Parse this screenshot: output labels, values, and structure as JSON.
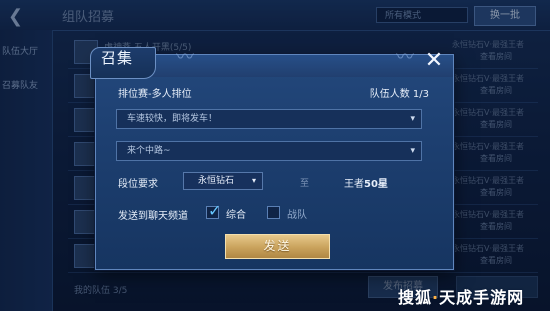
{
  "background": {
    "top_title": "组队招募",
    "top_select": "所有模式",
    "top_button": "换一批",
    "sidebar": [
      "队伍大厅",
      "召募队友"
    ],
    "rows": [
      {
        "name": "虎神燕  五人开黑(5/5)",
        "rank": "永恒钻石V·最强王者",
        "action": "查看房间"
      },
      {
        "name": "",
        "rank": "永恒钻石V·最强王者",
        "action": "查看房间"
      },
      {
        "name": "",
        "rank": "永恒钻石V·最强王者",
        "action": "查看房间"
      },
      {
        "name": "",
        "rank": "永恒钻石V·最强王者",
        "action": "查看房间"
      },
      {
        "name": "",
        "rank": "永恒钻石V·最强王者",
        "action": "查看房间"
      },
      {
        "name": "",
        "rank": "永恒钻石V·最强王者",
        "action": "查看房间"
      },
      {
        "name": "",
        "rank": "永恒钻石V·最强王者",
        "action": "查看房间"
      }
    ],
    "my_team": "我的队伍 3/5",
    "bottom_button": "发布招募"
  },
  "dialog": {
    "title": "召集",
    "close": "✕",
    "mode_label": "排位赛-多人排位",
    "team_count": "队伍人数 1/3",
    "message_select": "车速较快，即将发车！",
    "lane_select": "来个中路~",
    "rank_label": "段位要求",
    "rank_from": "永恒钻石",
    "to_text": "至",
    "rank_to": "王者",
    "rank_to_stars": "50星",
    "send_to_label": "发送到聊天频道",
    "option_general": "综合",
    "option_general_checked": true,
    "option_team": "战队",
    "option_team_checked": false,
    "send_button": "发送"
  },
  "watermark": {
    "prefix": "搜狐",
    "accent": "·",
    "suffix": "天成手游网"
  },
  "colors": {
    "gold_button": "#c9a25c",
    "dialog_bg": "#1d3f70",
    "check": "#66c7ff"
  }
}
